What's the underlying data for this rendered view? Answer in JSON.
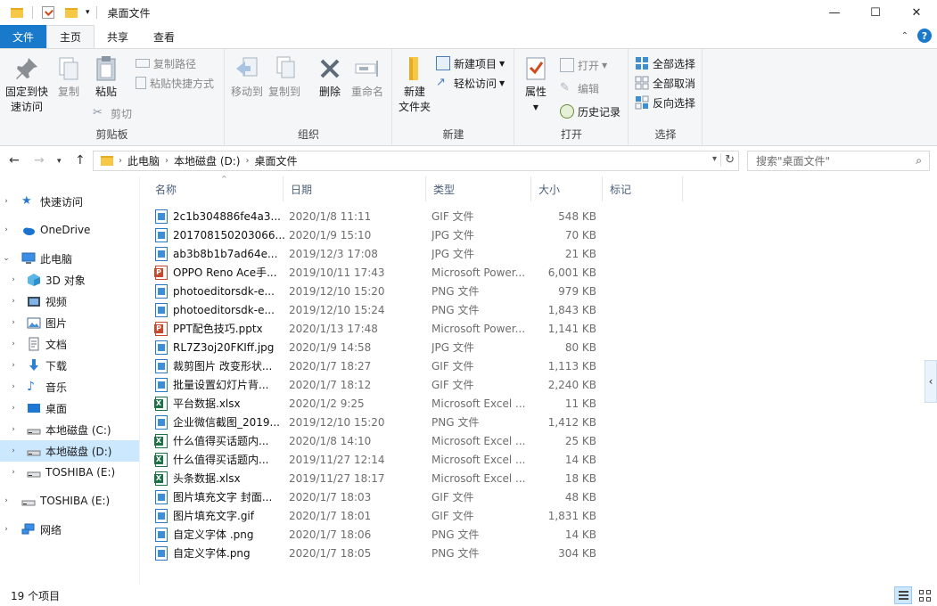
{
  "window": {
    "title": "桌面文件",
    "minimize": "—",
    "maximize": "☐",
    "close": "✕"
  },
  "ribbon_tabs": [
    {
      "label": "文件"
    },
    {
      "label": "主页"
    },
    {
      "label": "共享"
    },
    {
      "label": "查看"
    }
  ],
  "ribbon": {
    "clipboard": {
      "pin_line1": "固定到快",
      "pin_line2": "速访问",
      "copy": "复制",
      "paste": "粘贴",
      "copy_path": "复制路径",
      "paste_shortcut": "粘贴快捷方式",
      "cut": "剪切",
      "label": "剪贴板"
    },
    "organize": {
      "move_to": "移动到",
      "copy_to": "复制到",
      "delete": "删除",
      "rename": "重命名",
      "label": "组织"
    },
    "new": {
      "new_folder_line1": "新建",
      "new_folder_line2": "文件夹",
      "new_item": "新建项目",
      "easy_access": "轻松访问",
      "label": "新建"
    },
    "open": {
      "properties": "属性",
      "open": "打开",
      "edit": "编辑",
      "history": "历史记录",
      "label": "打开"
    },
    "select": {
      "select_all": "全部选择",
      "select_none": "全部取消",
      "invert": "反向选择",
      "label": "选择"
    }
  },
  "address": {
    "crumbs": [
      "此电脑",
      "本地磁盘 (D:)",
      "桌面文件"
    ],
    "search_placeholder": "搜索\"桌面文件\""
  },
  "nav": [
    {
      "label": "快速访问",
      "icon": "star-icon"
    },
    {
      "label": "OneDrive",
      "icon": "cloud-icon"
    },
    {
      "label": "此电脑",
      "icon": "computer-icon"
    },
    {
      "label": "3D 对象",
      "icon": "cube-icon"
    },
    {
      "label": "视频",
      "icon": "video-icon"
    },
    {
      "label": "图片",
      "icon": "picture-icon"
    },
    {
      "label": "文档",
      "icon": "document-icon"
    },
    {
      "label": "下载",
      "icon": "download-icon"
    },
    {
      "label": "音乐",
      "icon": "music-icon"
    },
    {
      "label": "桌面",
      "icon": "desktop-icon"
    },
    {
      "label": "本地磁盘 (C:)",
      "icon": "drive-icon"
    },
    {
      "label": "本地磁盘 (D:)",
      "icon": "drive-icon"
    },
    {
      "label": "TOSHIBA (E:)",
      "icon": "usb-drive-icon"
    },
    {
      "label": "TOSHIBA (E:)",
      "icon": "usb-drive-icon"
    },
    {
      "label": "网络",
      "icon": "network-icon"
    }
  ],
  "columns": {
    "name": "名称",
    "date": "日期",
    "type": "类型",
    "size": "大小",
    "tags": "标记"
  },
  "files": [
    {
      "name": "2c1b304886fe4a3...",
      "date": "2020/1/8 11:11",
      "type": "GIF 文件",
      "size": "548 KB",
      "kind": "img"
    },
    {
      "name": "201708150203066...",
      "date": "2020/1/9 15:10",
      "type": "JPG 文件",
      "size": "70 KB",
      "kind": "img"
    },
    {
      "name": "ab3b8b1b7ad64e...",
      "date": "2019/12/3 17:08",
      "type": "JPG 文件",
      "size": "21 KB",
      "kind": "img"
    },
    {
      "name": "OPPO Reno Ace手...",
      "date": "2019/10/11 17:43",
      "type": "Microsoft Power...",
      "size": "6,001 KB",
      "kind": "ppt"
    },
    {
      "name": "photoeditorsdk-e...",
      "date": "2019/12/10 15:20",
      "type": "PNG 文件",
      "size": "979 KB",
      "kind": "img"
    },
    {
      "name": "photoeditorsdk-e...",
      "date": "2019/12/10 15:24",
      "type": "PNG 文件",
      "size": "1,843 KB",
      "kind": "img"
    },
    {
      "name": "PPT配色技巧.pptx",
      "date": "2020/1/13 17:48",
      "type": "Microsoft Power...",
      "size": "1,141 KB",
      "kind": "ppt"
    },
    {
      "name": "RL7Z3oj20FKIff.jpg",
      "date": "2020/1/9 14:58",
      "type": "JPG 文件",
      "size": "80 KB",
      "kind": "img"
    },
    {
      "name": "裁剪图片 改变形状...",
      "date": "2020/1/7 18:27",
      "type": "GIF 文件",
      "size": "1,113 KB",
      "kind": "img"
    },
    {
      "name": "批量设置幻灯片背...",
      "date": "2020/1/7 18:12",
      "type": "GIF 文件",
      "size": "2,240 KB",
      "kind": "img"
    },
    {
      "name": "平台数据.xlsx",
      "date": "2020/1/2 9:25",
      "type": "Microsoft Excel ...",
      "size": "11 KB",
      "kind": "xls"
    },
    {
      "name": "企业微信截图_2019...",
      "date": "2019/12/10 15:20",
      "type": "PNG 文件",
      "size": "1,412 KB",
      "kind": "img"
    },
    {
      "name": "什么值得买话题内...",
      "date": "2020/1/8 14:10",
      "type": "Microsoft Excel ...",
      "size": "25 KB",
      "kind": "xls"
    },
    {
      "name": "什么值得买话题内...",
      "date": "2019/11/27 12:14",
      "type": "Microsoft Excel ...",
      "size": "14 KB",
      "kind": "xls"
    },
    {
      "name": "头条数据.xlsx",
      "date": "2019/11/27 18:17",
      "type": "Microsoft Excel ...",
      "size": "18 KB",
      "kind": "xls"
    },
    {
      "name": "图片填充文字 封面...",
      "date": "2020/1/7 18:03",
      "type": "GIF 文件",
      "size": "48 KB",
      "kind": "img"
    },
    {
      "name": "图片填充文字.gif",
      "date": "2020/1/7 18:01",
      "type": "GIF 文件",
      "size": "1,831 KB",
      "kind": "img"
    },
    {
      "name": "自定义字体 .png",
      "date": "2020/1/7 18:06",
      "type": "PNG 文件",
      "size": "14 KB",
      "kind": "img"
    },
    {
      "name": "自定义字体.png",
      "date": "2020/1/7 18:05",
      "type": "PNG 文件",
      "size": "304 KB",
      "kind": "img"
    }
  ],
  "status": {
    "item_count": "19 个项目"
  }
}
